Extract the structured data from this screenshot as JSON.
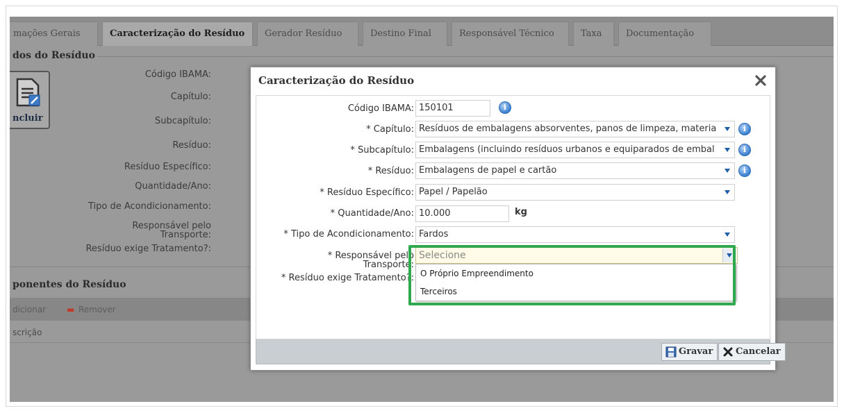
{
  "tabs": [
    {
      "label": "mações Gerais"
    },
    {
      "label": "Caracterização do Resíduo"
    },
    {
      "label": "Gerador Resíduo"
    },
    {
      "label": "Destino Final"
    },
    {
      "label": "Responsável Técnico"
    },
    {
      "label": "Taxa"
    },
    {
      "label": "Documentação"
    }
  ],
  "background": {
    "section_title": "dos do Resíduo",
    "incluir_label": "ncluir",
    "labels": [
      "Código IBAMA:",
      "Capítulo:",
      "Subcapítulo:",
      "Resíduo:",
      "Resíduo Específico:",
      "Quantidade/Ano:",
      "Tipo de Acondicionamento:",
      "Responsável pelo Transporte:",
      "Resíduo exige Tratamento?:"
    ],
    "components_title": "ponentes do Resíduo",
    "add_label": "dicionar",
    "remove_label": "Remover",
    "col_label": "scrição"
  },
  "modal": {
    "title": "Caracterização do Resíduo",
    "fields": {
      "codigo_label": "Código IBAMA:",
      "codigo_value": "150101",
      "capitulo_label": "* Capítulo:",
      "capitulo_value": "Resíduos de embalagens absorventes, panos de limpeza, materia",
      "subcapitulo_label": "* Subcapítulo:",
      "subcapitulo_value": "Embalagens (incluindo resíduos urbanos e equiparados de embal",
      "residuo_label": "* Resíduo:",
      "residuo_value": "Embalagens de papel e cartão",
      "especifico_label": "* Resíduo Específico:",
      "especifico_value": "Papel / Papelão",
      "quantidade_label": "* Quantidade/Ano:",
      "quantidade_value": "10.000",
      "quantidade_unit": "kg",
      "acond_label": "* Tipo de Acondicionamento:",
      "acond_value": "Fardos",
      "transporte_label_1": "* Responsável pelo",
      "transporte_label_2": "Transporte:",
      "transporte_placeholder": "Selecione",
      "tratamento_label": "* Resíduo exige Tratamento?:"
    },
    "dropdown_options": [
      "O Próprio Empreendimento",
      "Terceiros"
    ],
    "buttons": {
      "save": "Gravar",
      "cancel": "Cancelar"
    }
  },
  "colors": {
    "highlight": "#2fa84f",
    "info": "#3a7fd0",
    "caret": "#1f5fa8"
  }
}
